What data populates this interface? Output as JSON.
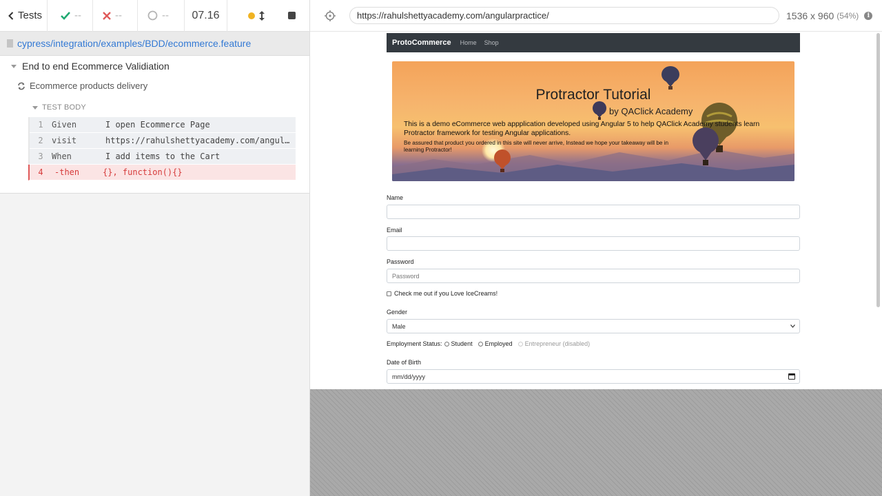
{
  "reporter": {
    "tests_label": "Tests",
    "passed": "--",
    "failed": "--",
    "pending": "--",
    "duration": "07.16",
    "spec_path": "cypress/integration/examples/BDD/ecommerce.feature",
    "suite_title": "End to end Ecommerce Validiation",
    "test_title": "Ecommerce products delivery",
    "body_title": "TEST BODY",
    "commands": [
      {
        "num": "1",
        "name": "Given",
        "message": "I open Ecommerce Page"
      },
      {
        "num": "2",
        "name": "visit",
        "message": "https://rahulshettyacademy.com/angularpractice/"
      },
      {
        "num": "3",
        "name": "When",
        "message": "I add items to the Cart"
      },
      {
        "num": "4",
        "name": "-then",
        "message": "{}, function(){}"
      }
    ],
    "colors": {
      "pass": "#1fa971",
      "fail": "#e05a5a",
      "running": "#f0b323",
      "link": "#3379d4"
    }
  },
  "aut": {
    "url": "https://rahulshettyacademy.com/angularpractice/",
    "viewport": "1536 x 960",
    "zoom": "(54%)",
    "info_icon": "i"
  },
  "page": {
    "brand": "ProtoCommerce",
    "nav": [
      "Home",
      "Shop"
    ],
    "banner": {
      "title": "Protractor Tutorial",
      "subtitle": "by QAClick Academy",
      "description": "This is a demo eCommerce web appplication developed using Angular 5 to help QAClick Academy students learn Protractor framework for testing Angular applications.",
      "note": "Be assured that product you ordered in this site will never arrive, Instead we hope your takeaway will be in learning Protractor!"
    },
    "form": {
      "name_label": "Name",
      "email_label": "Email",
      "password_label": "Password",
      "password_placeholder": "Password",
      "checkbox_label": "Check me out if you Love IceCreams!",
      "gender_label": "Gender",
      "gender_value": "Male",
      "employment_label": "Employment Status:",
      "employment_options": [
        "Student",
        "Employed",
        "Entrepreneur (disabled)"
      ],
      "dob_label": "Date of Birth",
      "dob_placeholder": "mm/dd/yyyy"
    }
  }
}
